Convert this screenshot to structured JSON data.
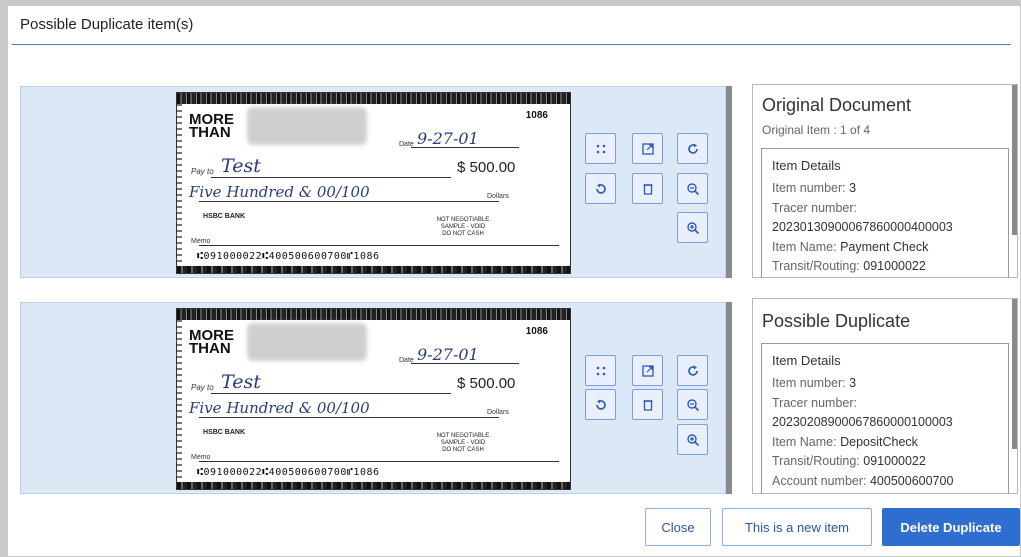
{
  "dialog": {
    "title": "Possible Duplicate item(s)"
  },
  "checks": [
    {
      "logo": "MORE\nTHAN",
      "check_number": "1086",
      "date_label": "Date",
      "date": "9-27-01",
      "payee_label": "Pay to",
      "payee": "Test",
      "amount": "$ 500.00",
      "amount_words": "Five Hundred & 00/100",
      "dollars_label": "Dollars",
      "bank": "HSBC BANK",
      "not_negotiable": "NOT NEGOTIABLE\nSAMPLE - VOID\nDO NOT CASH",
      "memo_label": "Memo",
      "micr": "⑆091000022⑆400500600700⑈1086"
    },
    {
      "logo": "MORE\nTHAN",
      "check_number": "1086",
      "date_label": "Date",
      "date": "9-27-01",
      "payee_label": "Pay to",
      "payee": "Test",
      "amount": "$ 500.00",
      "amount_words": "Five Hundred & 00/100",
      "dollars_label": "Dollars",
      "bank": "HSBC BANK",
      "not_negotiable": "NOT NEGOTIABLE\nSAMPLE - VOID\nDO NOT CASH",
      "memo_label": "Memo",
      "micr": "⑆091000022⑆400500600700⑈1086"
    }
  ],
  "toolbar_icons": [
    "fit-icon",
    "open-icon",
    "rotate-right-icon",
    "rotate-left-icon",
    "delete-icon",
    "zoom-out-icon",
    "zoom-in-icon"
  ],
  "original": {
    "title": "Original Document",
    "subtitle": "Original Item : 1 of 4",
    "details_header": "Item Details",
    "item_number_label": "Item number:",
    "item_number": "3",
    "tracer_label": "Tracer number:",
    "tracer": "20230130900067860000400003",
    "item_name_label": "Item Name:",
    "item_name": "Payment Check",
    "routing_label": "Transit/Routing:",
    "routing": "091000022"
  },
  "duplicate": {
    "title": "Possible Duplicate",
    "details_header": "Item Details",
    "item_number_label": "Item number:",
    "item_number": "3",
    "tracer_label": "Tracer number:",
    "tracer": "20230208900067860000100003",
    "item_name_label": "Item Name:",
    "item_name": "DepositCheck",
    "routing_label": "Transit/Routing:",
    "routing": "091000022",
    "account_label": "Account number:",
    "account": "400500600700"
  },
  "buttons": {
    "close": "Close",
    "new_item": "This is a new item",
    "delete": "Delete Duplicate"
  },
  "colors": {
    "accent": "#2f6ed1",
    "row_bg": "#dde8f7",
    "ink": "#2a3c7a"
  }
}
